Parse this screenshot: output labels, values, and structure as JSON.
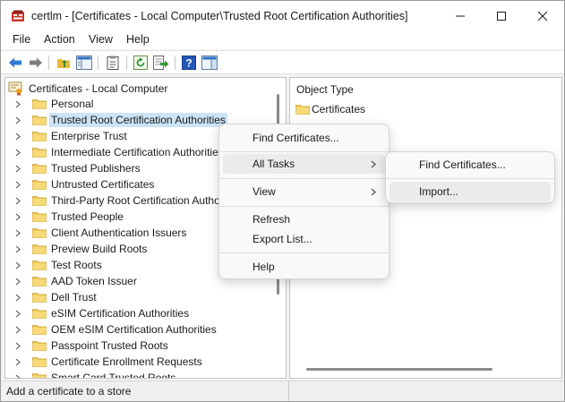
{
  "window": {
    "title": "certlm - [Certificates - Local Computer\\Trusted Root Certification Authorities]"
  },
  "menubar": [
    "File",
    "Action",
    "View",
    "Help"
  ],
  "toolbar": {
    "buttons": [
      "back-arrow-icon",
      "forward-arrow-icon",
      "up-folder-icon",
      "show-hide-tree-icon",
      "properties-icon",
      "refresh-icon",
      "export-list-icon",
      "help-icon",
      "action-pane-icon"
    ]
  },
  "tree": {
    "root": "Certificates - Local Computer",
    "items": [
      "Personal",
      "Trusted Root Certification Authorities",
      "Enterprise Trust",
      "Intermediate Certification Authorities",
      "Trusted Publishers",
      "Untrusted Certificates",
      "Third-Party Root Certification Authorities",
      "Trusted People",
      "Client Authentication Issuers",
      "Preview Build Roots",
      "Test Roots",
      "AAD Token Issuer",
      "Dell Trust",
      "eSIM Certification Authorities",
      "OEM eSIM Certification Authorities",
      "Passpoint Trusted Roots",
      "Certificate Enrollment Requests",
      "Smart Card Trusted Roots"
    ],
    "selected": "Trusted Root Certification Authorities"
  },
  "details": {
    "column_header": "Object Type",
    "rows": [
      "Certificates"
    ]
  },
  "context_menu": {
    "items": [
      "Find Certificates...",
      "All Tasks",
      "View",
      "Refresh",
      "Export List...",
      "Help"
    ],
    "highlighted": "All Tasks"
  },
  "submenu": {
    "items": [
      "Find Certificates...",
      "Import..."
    ],
    "highlighted": "Import..."
  },
  "statusbar": {
    "text": "Add a certificate to a store"
  },
  "colors": {
    "selection": "#cce4f7",
    "folder": "#f3cd5a",
    "accent_blue": "#1f6fc5"
  }
}
